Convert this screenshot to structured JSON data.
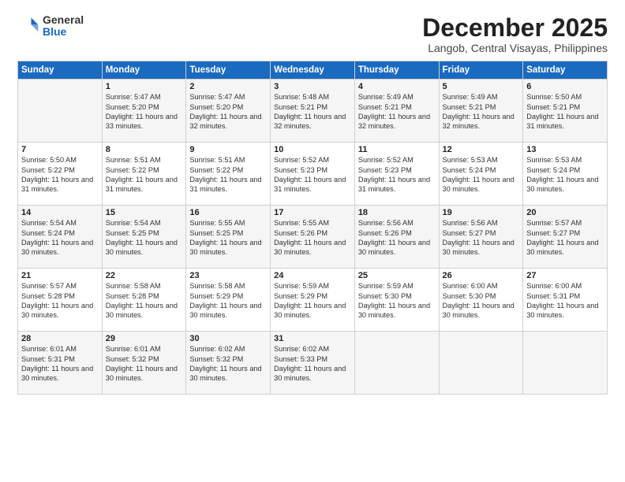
{
  "logo": {
    "general": "General",
    "blue": "Blue"
  },
  "title": "December 2025",
  "subtitle": "Langob, Central Visayas, Philippines",
  "headers": [
    "Sunday",
    "Monday",
    "Tuesday",
    "Wednesday",
    "Thursday",
    "Friday",
    "Saturday"
  ],
  "weeks": [
    [
      {
        "day": "",
        "text": ""
      },
      {
        "day": "1",
        "text": "Sunrise: 5:47 AM\nSunset: 5:20 PM\nDaylight: 11 hours\nand 33 minutes."
      },
      {
        "day": "2",
        "text": "Sunrise: 5:47 AM\nSunset: 5:20 PM\nDaylight: 11 hours\nand 32 minutes."
      },
      {
        "day": "3",
        "text": "Sunrise: 5:48 AM\nSunset: 5:21 PM\nDaylight: 11 hours\nand 32 minutes."
      },
      {
        "day": "4",
        "text": "Sunrise: 5:49 AM\nSunset: 5:21 PM\nDaylight: 11 hours\nand 32 minutes."
      },
      {
        "day": "5",
        "text": "Sunrise: 5:49 AM\nSunset: 5:21 PM\nDaylight: 11 hours\nand 32 minutes."
      },
      {
        "day": "6",
        "text": "Sunrise: 5:50 AM\nSunset: 5:21 PM\nDaylight: 11 hours\nand 31 minutes."
      }
    ],
    [
      {
        "day": "7",
        "text": "Sunrise: 5:50 AM\nSunset: 5:22 PM\nDaylight: 11 hours\nand 31 minutes."
      },
      {
        "day": "8",
        "text": "Sunrise: 5:51 AM\nSunset: 5:22 PM\nDaylight: 11 hours\nand 31 minutes."
      },
      {
        "day": "9",
        "text": "Sunrise: 5:51 AM\nSunset: 5:22 PM\nDaylight: 11 hours\nand 31 minutes."
      },
      {
        "day": "10",
        "text": "Sunrise: 5:52 AM\nSunset: 5:23 PM\nDaylight: 11 hours\nand 31 minutes."
      },
      {
        "day": "11",
        "text": "Sunrise: 5:52 AM\nSunset: 5:23 PM\nDaylight: 11 hours\nand 31 minutes."
      },
      {
        "day": "12",
        "text": "Sunrise: 5:53 AM\nSunset: 5:24 PM\nDaylight: 11 hours\nand 30 minutes."
      },
      {
        "day": "13",
        "text": "Sunrise: 5:53 AM\nSunset: 5:24 PM\nDaylight: 11 hours\nand 30 minutes."
      }
    ],
    [
      {
        "day": "14",
        "text": "Sunrise: 5:54 AM\nSunset: 5:24 PM\nDaylight: 11 hours\nand 30 minutes."
      },
      {
        "day": "15",
        "text": "Sunrise: 5:54 AM\nSunset: 5:25 PM\nDaylight: 11 hours\nand 30 minutes."
      },
      {
        "day": "16",
        "text": "Sunrise: 5:55 AM\nSunset: 5:25 PM\nDaylight: 11 hours\nand 30 minutes."
      },
      {
        "day": "17",
        "text": "Sunrise: 5:55 AM\nSunset: 5:26 PM\nDaylight: 11 hours\nand 30 minutes."
      },
      {
        "day": "18",
        "text": "Sunrise: 5:56 AM\nSunset: 5:26 PM\nDaylight: 11 hours\nand 30 minutes."
      },
      {
        "day": "19",
        "text": "Sunrise: 5:56 AM\nSunset: 5:27 PM\nDaylight: 11 hours\nand 30 minutes."
      },
      {
        "day": "20",
        "text": "Sunrise: 5:57 AM\nSunset: 5:27 PM\nDaylight: 11 hours\nand 30 minutes."
      }
    ],
    [
      {
        "day": "21",
        "text": "Sunrise: 5:57 AM\nSunset: 5:28 PM\nDaylight: 11 hours\nand 30 minutes."
      },
      {
        "day": "22",
        "text": "Sunrise: 5:58 AM\nSunset: 5:28 PM\nDaylight: 11 hours\nand 30 minutes."
      },
      {
        "day": "23",
        "text": "Sunrise: 5:58 AM\nSunset: 5:29 PM\nDaylight: 11 hours\nand 30 minutes."
      },
      {
        "day": "24",
        "text": "Sunrise: 5:59 AM\nSunset: 5:29 PM\nDaylight: 11 hours\nand 30 minutes."
      },
      {
        "day": "25",
        "text": "Sunrise: 5:59 AM\nSunset: 5:30 PM\nDaylight: 11 hours\nand 30 minutes."
      },
      {
        "day": "26",
        "text": "Sunrise: 6:00 AM\nSunset: 5:30 PM\nDaylight: 11 hours\nand 30 minutes."
      },
      {
        "day": "27",
        "text": "Sunrise: 6:00 AM\nSunset: 5:31 PM\nDaylight: 11 hours\nand 30 minutes."
      }
    ],
    [
      {
        "day": "28",
        "text": "Sunrise: 6:01 AM\nSunset: 5:31 PM\nDaylight: 11 hours\nand 30 minutes."
      },
      {
        "day": "29",
        "text": "Sunrise: 6:01 AM\nSunset: 5:32 PM\nDaylight: 11 hours\nand 30 minutes."
      },
      {
        "day": "30",
        "text": "Sunrise: 6:02 AM\nSunset: 5:32 PM\nDaylight: 11 hours\nand 30 minutes."
      },
      {
        "day": "31",
        "text": "Sunrise: 6:02 AM\nSunset: 5:33 PM\nDaylight: 11 hours\nand 30 minutes."
      },
      {
        "day": "",
        "text": ""
      },
      {
        "day": "",
        "text": ""
      },
      {
        "day": "",
        "text": ""
      }
    ]
  ]
}
